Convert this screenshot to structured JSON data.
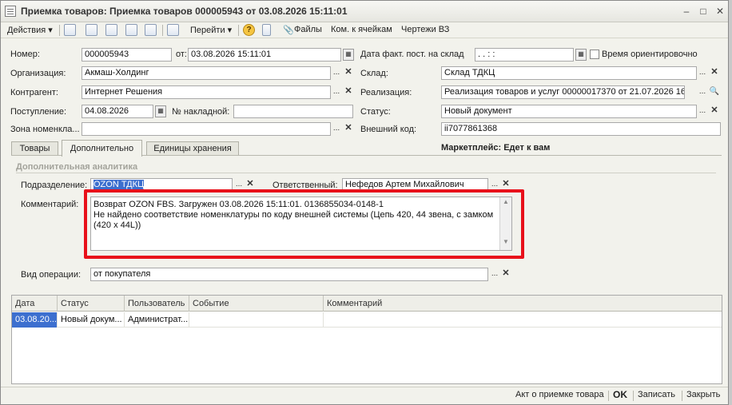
{
  "window": {
    "title": "Приемка товаров: Приемка товаров 000005943 от 03.08.2026 15:11:01",
    "controls": [
      "minimize-icon",
      "maximize-icon",
      "close-icon"
    ]
  },
  "toolbar": {
    "actions_label": "Действия",
    "goto_label": "Перейти",
    "files_label": "Файлы",
    "cells_label": "Ком. к ячейкам",
    "drawings_label": "Чертежи ВЗ"
  },
  "header": {
    "number_label": "Номер:",
    "number_value": "000005943",
    "from_label": "от:",
    "from_value": "03.08.2026 15:11:01",
    "fact_date_label": "Дата факт. пост. на склад",
    "fact_date_value": "  .  .     :  :",
    "time_approx_label": "Время ориентировочно",
    "org_label": "Организация:",
    "org_value": "Акмаш-Холдинг",
    "warehouse_label": "Склад:",
    "warehouse_value": "Склад ТДКЦ",
    "contractor_label": "Контрагент:",
    "contractor_value": "Интернет Решения",
    "realization_label": "Реализация:",
    "realization_value": "Реализация товаров и услуг 00000017370 от 21.07.2026 16",
    "arrival_label": "Поступление:",
    "arrival_value": "04.08.2026",
    "invoice_label": "№ накладной:",
    "invoice_value": "",
    "status_label": "Статус:",
    "status_value": "Новый документ",
    "zone_label": "Зона номенкла...",
    "zone_value": "",
    "external_code_label": "Внешний код:",
    "external_code_value": "ii7077861368",
    "marketplace_text": "Маркетплейс: Едет к вам"
  },
  "tabs": [
    {
      "label": "Товары"
    },
    {
      "label": "Дополнительно"
    },
    {
      "label": "Единицы хранения"
    }
  ],
  "additional": {
    "group_title": "Дополнительная аналитика",
    "division_label": "Подразделение:",
    "division_value": "OZON ТДКЦ",
    "responsible_label": "Ответственный:",
    "responsible_value": "Нефедов Артем Михайлович",
    "comment_label": "Комментарий:",
    "comment_line1": "Возврат OZON FBS. Загружен 03.08.2026 15:11:01. 0136855034-0148-1",
    "comment_line2": "Не найдено соответствие номенклатуры по коду внешней системы (Цепь 420, 44 звена, с замком",
    "comment_line3": "(420 x 44L))",
    "operation_label": "Вид операции:",
    "operation_value": "от покупателя"
  },
  "history_table": {
    "columns": [
      "Дата",
      "Статус",
      "Пользователь",
      "Событие",
      "Комментарий"
    ],
    "rows": [
      [
        "03.08.20...",
        "Новый докум...",
        "Администрат...",
        "",
        ""
      ]
    ]
  },
  "footer": {
    "act_label": "Акт о приемке товара",
    "ok_label": "OK",
    "save_label": "Записать",
    "close_label": "Закрыть"
  },
  "colors": {
    "highlight": "#e8101a",
    "selection": "#3c6fcf"
  }
}
